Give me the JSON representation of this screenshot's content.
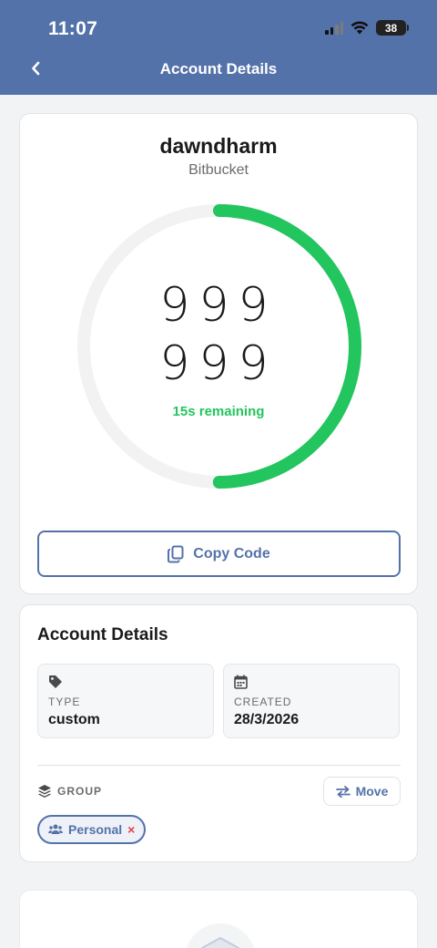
{
  "status_bar": {
    "time": "11:07",
    "battery": "38"
  },
  "header": {
    "title": "Account Details",
    "back_icon": "chevron-left-icon"
  },
  "account": {
    "name": "dawndharm",
    "issuer": "Bitbucket",
    "code_line1": "999",
    "code_line2": "999",
    "remaining": "15s remaining",
    "progress_fraction": 0.5,
    "colors": {
      "progress": "#22c55e",
      "track": "#f2f2f2",
      "accent": "#5472aa"
    }
  },
  "copy_button": {
    "label": "Copy Code",
    "icon": "copy-icon"
  },
  "details": {
    "title": "Account Details",
    "type_label": "TYPE",
    "type_value": "custom",
    "created_label": "CREATED",
    "created_value": "28/3/2026",
    "group_label": "GROUP",
    "move_label": "Move",
    "group_chip": "Personal",
    "chip_remove": "×"
  }
}
